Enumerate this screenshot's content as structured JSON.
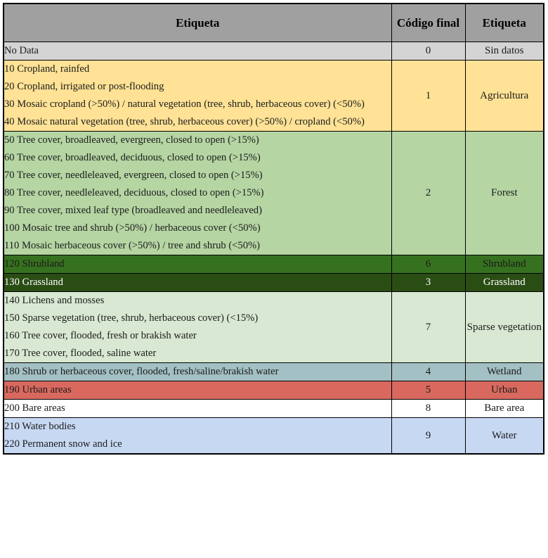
{
  "table": {
    "headers": {
      "description": "Etiqueta",
      "code": "Código final",
      "label": "Etiqueta"
    },
    "rows": [
      {
        "name": "no-data",
        "lines": [
          "No Data"
        ],
        "code": "0",
        "label": "Sin datos",
        "bg": "#d4d4d4",
        "text": "#1b1b1b"
      },
      {
        "name": "agriculture",
        "lines": [
          "10 Cropland, rainfed",
          "20 Cropland, irrigated or post-flooding",
          "30 Mosaic cropland (>50%) / natural vegetation (tree, shrub, herbaceous cover) (<50%)",
          "40 Mosaic natural vegetation (tree, shrub, herbaceous cover) (>50%) / cropland (<50%)"
        ],
        "code": "1",
        "label": "Agricultura",
        "bg": "#ffe295",
        "text": "#1b1b1b"
      },
      {
        "name": "forest",
        "lines": [
          "50 Tree cover, broadleaved, evergreen, closed to open (>15%)",
          "60 Tree cover, broadleaved, deciduous, closed to open (>15%)",
          "70 Tree cover, needleleaved, evergreen, closed to open (>15%)",
          "80 Tree cover, needleleaved, deciduous, closed to open (>15%)",
          "90 Tree cover, mixed leaf type (broadleaved and needleleaved)",
          "100 Mosaic tree and shrub (>50%) / herbaceous cover (<50%)",
          "110 Mosaic herbaceous cover (>50%) / tree and shrub (<50%)"
        ],
        "code": "2",
        "label": "Forest",
        "bg": "#b5d5a3",
        "text": "#1b1b1b"
      },
      {
        "name": "shrubland",
        "lines": [
          "120 Shrubland"
        ],
        "code": "6",
        "label": "Shrubland",
        "bg": "#36711f",
        "text": "#1b1b1b"
      },
      {
        "name": "grassland",
        "lines": [
          "130 Grassland"
        ],
        "code": "3",
        "label": "Grassland",
        "bg": "#2a4d14",
        "text": "#ffffff"
      },
      {
        "name": "sparse-vegetation",
        "lines": [
          "140 Lichens and mosses",
          "150 Sparse vegetation (tree, shrub, herbaceous cover) (<15%)",
          "160 Tree cover, flooded, fresh or brakish water",
          "170 Tree cover, flooded, saline water"
        ],
        "code": "7",
        "label": "Sparse vegetation",
        "bg": "#d8e8d2",
        "text": "#1b1b1b"
      },
      {
        "name": "wetland",
        "lines": [
          "180 Shrub or herbaceous cover, flooded, fresh/saline/brakish water"
        ],
        "code": "4",
        "label": "Wetland",
        "bg": "#a3c0c4",
        "text": "#1b1b1b"
      },
      {
        "name": "urban",
        "lines": [
          "190 Urban areas"
        ],
        "code": "5",
        "label": "Urban",
        "bg": "#d9695f",
        "text": "#1b1b1b"
      },
      {
        "name": "bare-area",
        "lines": [
          "200 Bare areas"
        ],
        "code": "8",
        "label": "Bare area",
        "bg": "#ffffff",
        "text": "#1b1b1b"
      },
      {
        "name": "water",
        "lines": [
          "210 Water bodies",
          "220 Permanent snow and ice"
        ],
        "code": "9",
        "label": "Water",
        "bg": "#c7d8f3",
        "text": "#1b1b1b"
      }
    ]
  }
}
